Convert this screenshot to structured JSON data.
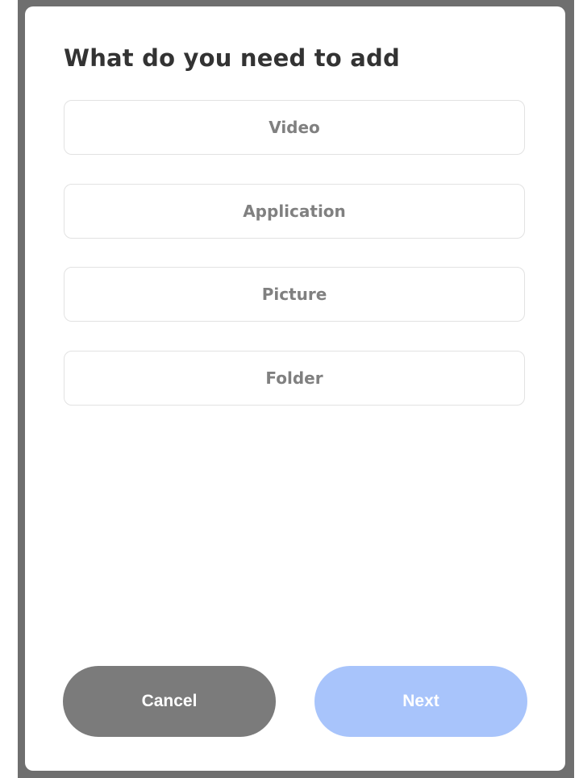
{
  "dialog": {
    "title": "What do you need to add",
    "options": [
      {
        "label": "Video"
      },
      {
        "label": "Application"
      },
      {
        "label": "Picture"
      },
      {
        "label": "Folder"
      }
    ],
    "cancel_label": "Cancel",
    "next_label": "Next"
  },
  "colors": {
    "cancel_button": "#7b7b7b",
    "next_button_disabled": "#a8c4fb",
    "title_text": "#333333",
    "option_text": "#808080"
  }
}
